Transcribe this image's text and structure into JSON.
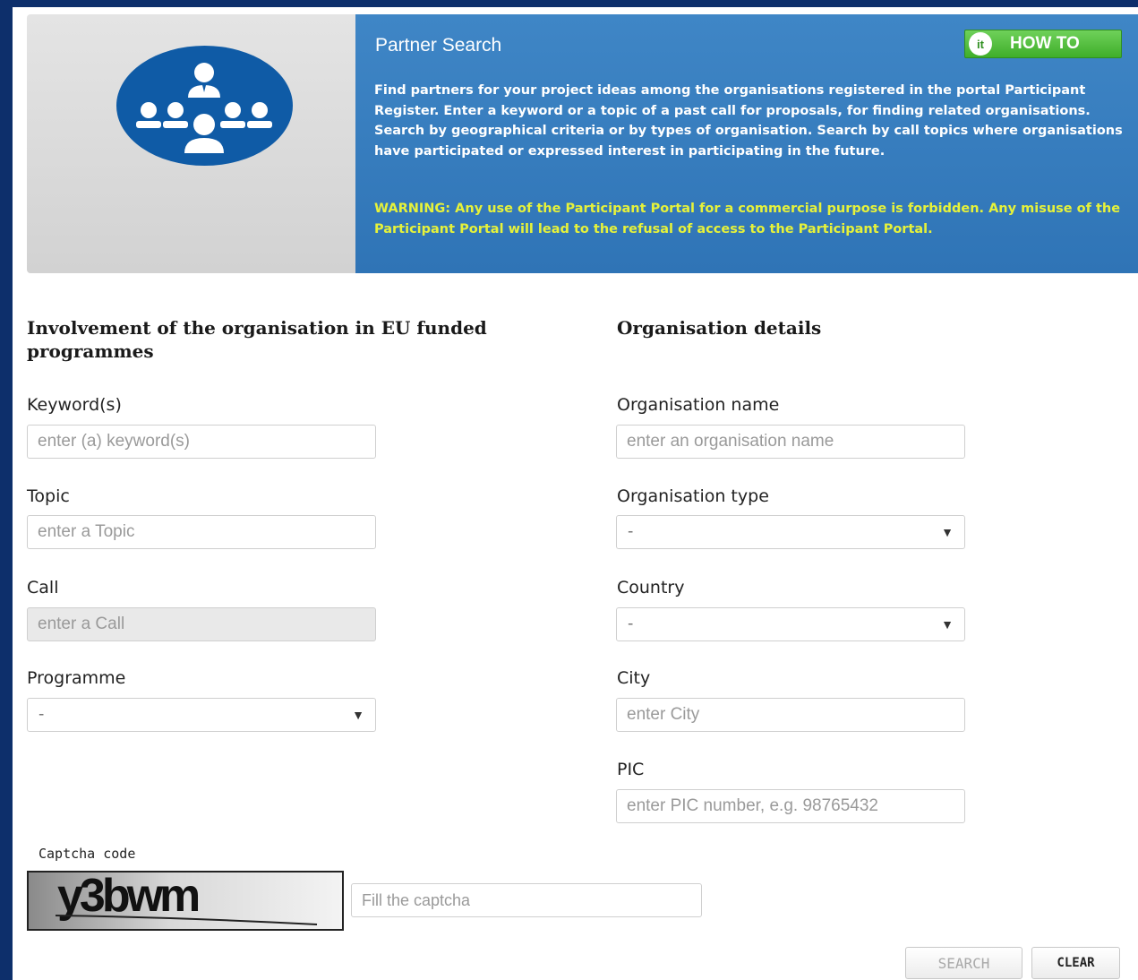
{
  "banner": {
    "title": "Partner Search",
    "howto_label": "HOW TO",
    "howto_icon": "it",
    "description": "Find partners for your project ideas among the organisations registered in the portal Participant Register. Enter a keyword or a topic of a past call for proposals, for finding related organisations. Search by geographical criteria or by types of organisation. Search by call topics where organisations have participated or expressed interest in participating in the future.",
    "warning": "WARNING: Any use of the Participant Portal for a commercial purpose is forbidden. Any misuse of the Participant Portal will lead to the refusal of access to the Participant Portal.",
    "logo_icon": "partner-group-icon"
  },
  "left_section": {
    "heading": "Involvement of the organisation in EU funded programmes",
    "keyword": {
      "label": "Keyword(s)",
      "placeholder": "enter (a) keyword(s)"
    },
    "topic": {
      "label": "Topic",
      "placeholder": "enter a Topic"
    },
    "call": {
      "label": "Call",
      "placeholder": "enter a Call"
    },
    "programme": {
      "label": "Programme",
      "value": "-"
    }
  },
  "right_section": {
    "heading": "Organisation details",
    "org_name": {
      "label": "Organisation name",
      "placeholder": "enter an organisation name"
    },
    "org_type": {
      "label": "Organisation type",
      "value": "-"
    },
    "country": {
      "label": "Country",
      "value": "-"
    },
    "city": {
      "label": "City",
      "placeholder": "enter City"
    },
    "pic": {
      "label": "PIC",
      "placeholder": "enter PIC number, e.g. 98765432"
    }
  },
  "captcha": {
    "label": "Captcha code",
    "code": "y3bwm",
    "placeholder": "Fill the captcha"
  },
  "buttons": {
    "search": "SEARCH",
    "clear": "CLEAR"
  },
  "colors": {
    "banner_blue": "#3478ba",
    "logo_blue": "#0f5ba6",
    "warning_yellow": "#e6f23a",
    "howto_green": "#4cbb35",
    "page_border": "#0d2f6b"
  }
}
